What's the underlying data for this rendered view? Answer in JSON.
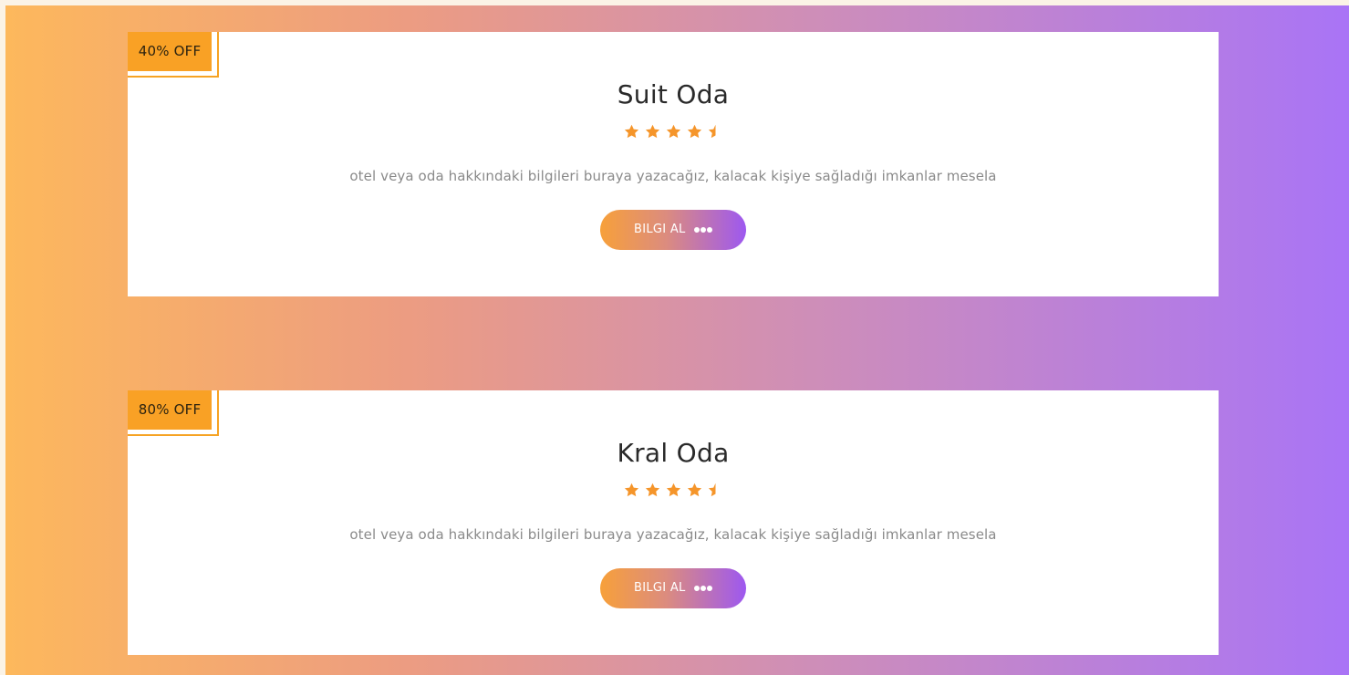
{
  "colors": {
    "accent_orange": "#f9a125",
    "accent_purple": "#a974f6",
    "star": "#f5952a"
  },
  "cards": [
    {
      "badge": "40% OFF",
      "title": "Suit Oda",
      "rating": 4.5,
      "rating_max": 5,
      "description": "otel veya oda hakkındaki bilgileri buraya yazacağız, kalacak kişiye sağladığı imkanlar mesela",
      "button_label": "BILGI AL",
      "button_icon": "more-dots-icon"
    },
    {
      "badge": "80% OFF",
      "title": "Kral Oda",
      "rating": 4.5,
      "rating_max": 5,
      "description": "otel veya oda hakkındaki bilgileri buraya yazacağız, kalacak kişiye sağladığı imkanlar mesela",
      "button_label": "BILGI AL",
      "button_icon": "more-dots-icon"
    }
  ]
}
